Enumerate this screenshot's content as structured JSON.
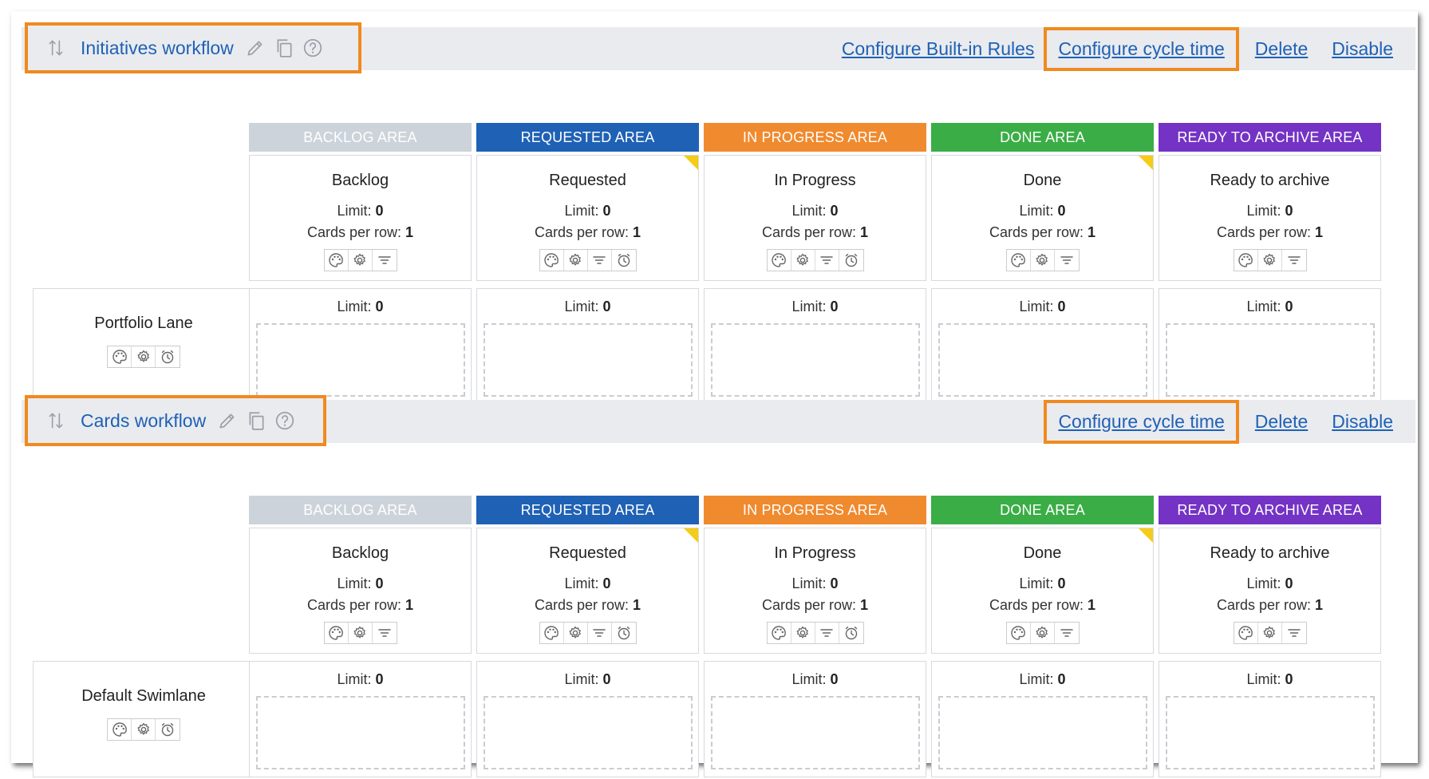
{
  "colors": {
    "link": "#1f61b5",
    "highlight": "#f08a1e",
    "backlog": "#cdd3da",
    "requested": "#1f61b5",
    "in_progress": "#f08a2e",
    "done": "#3bad46",
    "archive": "#7433c4",
    "flag": "#f5cc17"
  },
  "workflows": [
    {
      "title": "Initiatives workflow",
      "actions": {
        "built_in_rules": "Configure Built-in Rules",
        "cycle_time": "Configure cycle time",
        "delete": "Delete",
        "disable": "Disable"
      },
      "areas": [
        "BACKLOG AREA",
        "REQUESTED AREA",
        "IN PROGRESS AREA",
        "DONE AREA",
        "READY TO ARCHIVE AREA"
      ],
      "columns": [
        {
          "name": "Backlog",
          "limit_label": "Limit:",
          "limit": "0",
          "cpr_label": "Cards per row:",
          "cpr": "1",
          "flag": false,
          "timer": false
        },
        {
          "name": "Requested",
          "limit_label": "Limit:",
          "limit": "0",
          "cpr_label": "Cards per row:",
          "cpr": "1",
          "flag": true,
          "timer": true
        },
        {
          "name": "In Progress",
          "limit_label": "Limit:",
          "limit": "0",
          "cpr_label": "Cards per row:",
          "cpr": "1",
          "flag": false,
          "timer": true
        },
        {
          "name": "Done",
          "limit_label": "Limit:",
          "limit": "0",
          "cpr_label": "Cards per row:",
          "cpr": "1",
          "flag": true,
          "timer": false
        },
        {
          "name": "Ready to archive",
          "limit_label": "Limit:",
          "limit": "0",
          "cpr_label": "Cards per row:",
          "cpr": "1",
          "flag": false,
          "timer": false
        }
      ],
      "lane": {
        "name": "Portfolio Lane",
        "cells": [
          {
            "limit_label": "Limit:",
            "limit": "0"
          },
          {
            "limit_label": "Limit:",
            "limit": "0"
          },
          {
            "limit_label": "Limit:",
            "limit": "0"
          },
          {
            "limit_label": "Limit:",
            "limit": "0"
          },
          {
            "limit_label": "Limit:",
            "limit": "0"
          }
        ]
      }
    },
    {
      "title": "Cards workflow",
      "actions": {
        "cycle_time": "Configure cycle time",
        "delete": "Delete",
        "disable": "Disable"
      },
      "areas": [
        "BACKLOG AREA",
        "REQUESTED AREA",
        "IN PROGRESS AREA",
        "DONE AREA",
        "READY TO ARCHIVE AREA"
      ],
      "columns": [
        {
          "name": "Backlog",
          "limit_label": "Limit:",
          "limit": "0",
          "cpr_label": "Cards per row:",
          "cpr": "1",
          "flag": false,
          "timer": false
        },
        {
          "name": "Requested",
          "limit_label": "Limit:",
          "limit": "0",
          "cpr_label": "Cards per row:",
          "cpr": "1",
          "flag": true,
          "timer": true
        },
        {
          "name": "In Progress",
          "limit_label": "Limit:",
          "limit": "0",
          "cpr_label": "Cards per row:",
          "cpr": "1",
          "flag": false,
          "timer": true
        },
        {
          "name": "Done",
          "limit_label": "Limit:",
          "limit": "0",
          "cpr_label": "Cards per row:",
          "cpr": "1",
          "flag": true,
          "timer": false
        },
        {
          "name": "Ready to archive",
          "limit_label": "Limit:",
          "limit": "0",
          "cpr_label": "Cards per row:",
          "cpr": "1",
          "flag": false,
          "timer": false
        }
      ],
      "lane": {
        "name": "Default Swimlane",
        "cells": [
          {
            "limit_label": "Limit:",
            "limit": "0"
          },
          {
            "limit_label": "Limit:",
            "limit": "0"
          },
          {
            "limit_label": "Limit:",
            "limit": "0"
          },
          {
            "limit_label": "Limit:",
            "limit": "0"
          },
          {
            "limit_label": "Limit:",
            "limit": "0"
          }
        ]
      }
    }
  ]
}
